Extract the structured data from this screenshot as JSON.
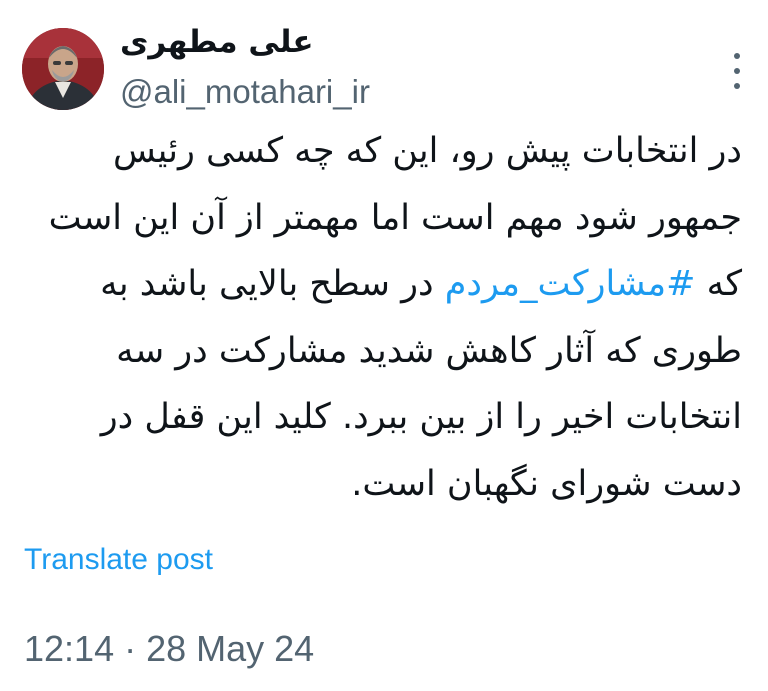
{
  "author": {
    "display_name": "علی مطهری",
    "handle": "@ali_motahari_ir"
  },
  "tweet": {
    "text_before": "در انتخابات پیش رو، این که چه کسی رئیس جمهور شود مهم است اما مهمتر از آن این است که ",
    "hashtag": "#مشارکت_مردم",
    "text_after": " در سطح بالایی باشد به طوری که آثار کاهش شدید مشارکت در سه انتخابات اخیر را از بین ببرد. کلید این قفل در دست شورای نگهبان است."
  },
  "translate_label": "Translate post",
  "timestamp": {
    "time": "12:14",
    "separator": " · ",
    "date": "28 May 24"
  },
  "icons": {
    "more": "more-options-icon",
    "avatar": "profile-photo"
  },
  "colors": {
    "link": "#1d9bf0",
    "secondary_text": "#536471",
    "primary_text": "#0f1419"
  }
}
